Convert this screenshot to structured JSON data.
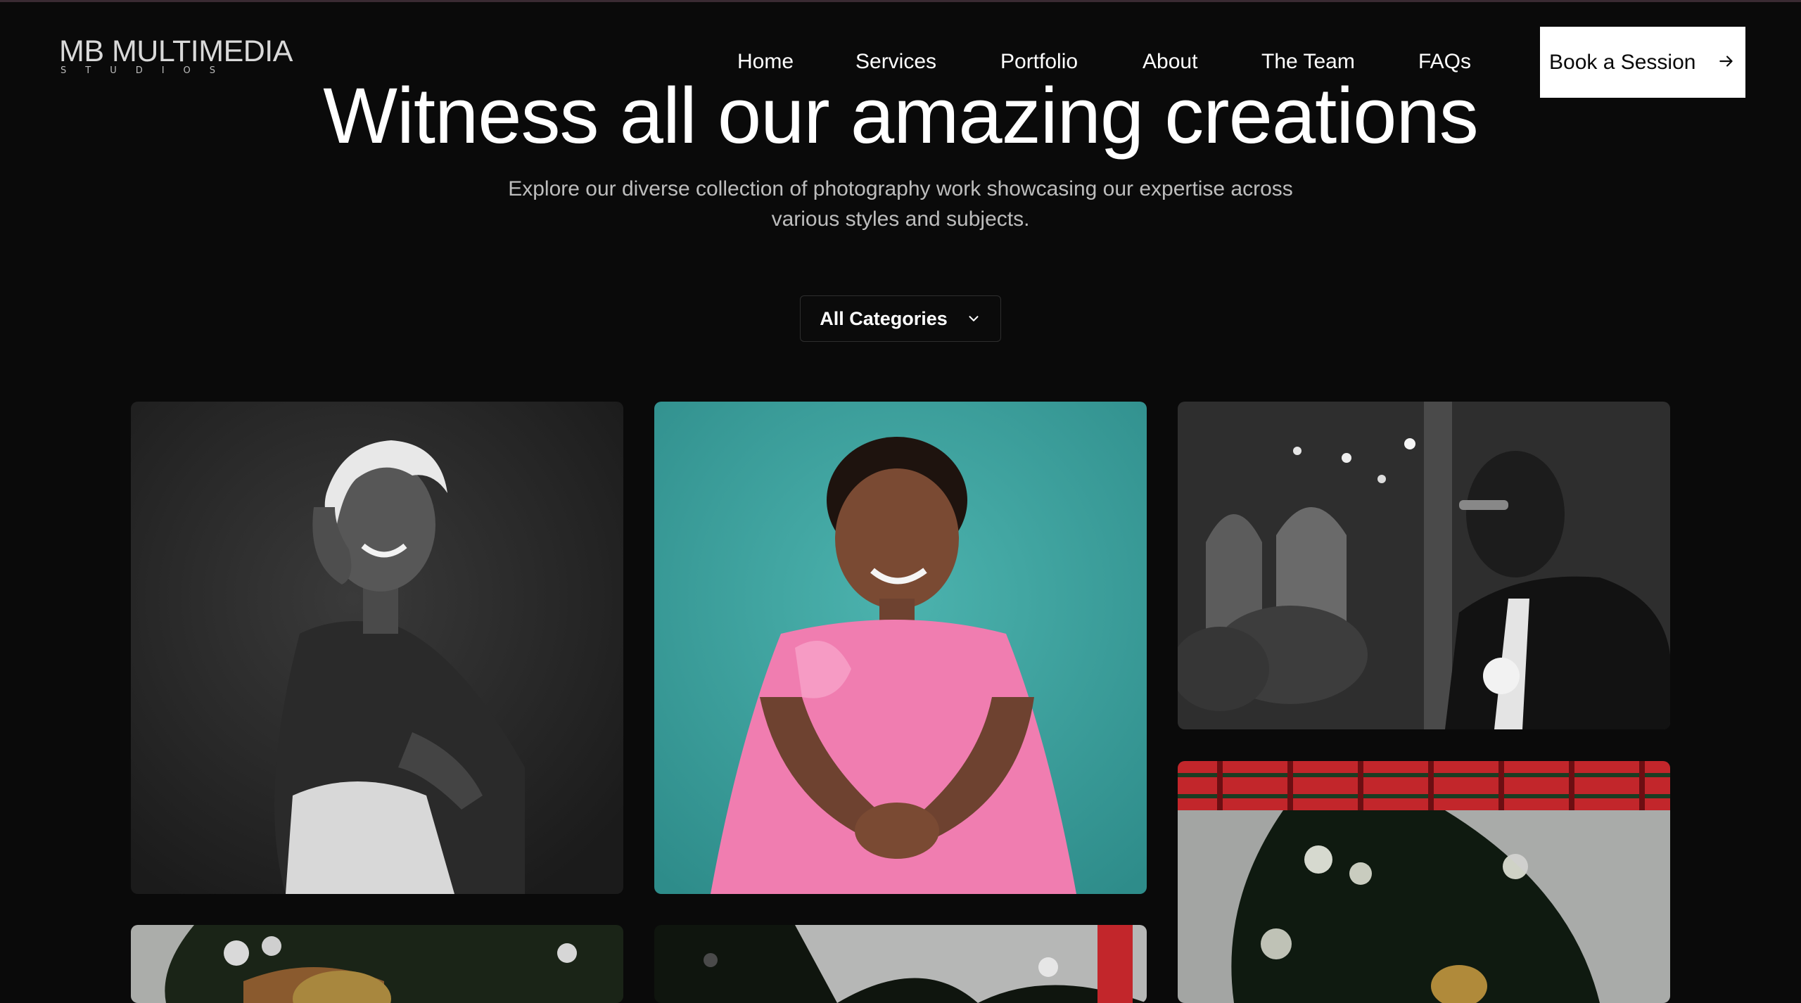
{
  "brand": {
    "name": "MB MULTIMEDIA",
    "tagline": "STUDIOS"
  },
  "nav": {
    "items": [
      {
        "label": "Home"
      },
      {
        "label": "Services"
      },
      {
        "label": "Portfolio"
      },
      {
        "label": "About"
      },
      {
        "label": "The Team"
      },
      {
        "label": "FAQs"
      }
    ],
    "cta_label": "Book a Session",
    "cta_icon": "arrow-right-icon"
  },
  "hero": {
    "title": "Witness all our amazing creations",
    "subtitle": "Explore our diverse collection of photography work showcasing our expertise across various styles and subjects."
  },
  "filter": {
    "selected": "All Categories",
    "icon": "chevron-down-icon"
  },
  "gallery": {
    "photos": [
      {
        "name": "bw-portrait-woman"
      },
      {
        "name": "girl-pink-dress-teal"
      },
      {
        "name": "bw-groom-church"
      },
      {
        "name": "traditional-wedding-decor"
      },
      {
        "name": "traditional-ceremony-seat"
      },
      {
        "name": "bead-curtain-decor"
      }
    ]
  },
  "colors": {
    "background": "#0a0a0a",
    "text": "#ffffff",
    "muted": "#bdbdbd",
    "cta_background": "#ffffff",
    "teal_backdrop": "#3fa6a3",
    "pink_dress": "#f27fb0"
  }
}
